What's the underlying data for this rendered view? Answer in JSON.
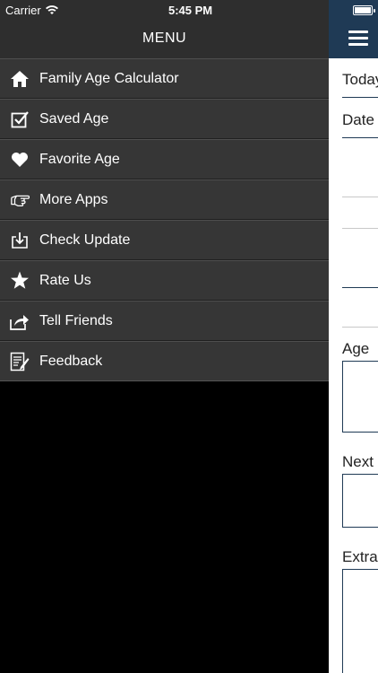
{
  "status": {
    "carrier": "Carrier",
    "time": "5:45 PM"
  },
  "menu": {
    "title": "MENU",
    "items": [
      {
        "label": "Family Age Calculator",
        "icon": "home-icon"
      },
      {
        "label": "Saved Age",
        "icon": "checkbox-icon"
      },
      {
        "label": "Favorite Age",
        "icon": "heart-icon"
      },
      {
        "label": "More Apps",
        "icon": "pointing-hand-icon"
      },
      {
        "label": "Check Update",
        "icon": "download-icon"
      },
      {
        "label": "Rate Us",
        "icon": "star-icon"
      },
      {
        "label": "Tell Friends",
        "icon": "share-icon"
      },
      {
        "label": "Feedback",
        "icon": "feedback-icon"
      }
    ]
  },
  "panel": {
    "labels": {
      "today": "Today",
      "date": "Date",
      "age": "Age",
      "next": "Next",
      "extra": "Extra"
    }
  },
  "colors": {
    "nav": "#1f3a55",
    "menu_bg": "#363636"
  }
}
